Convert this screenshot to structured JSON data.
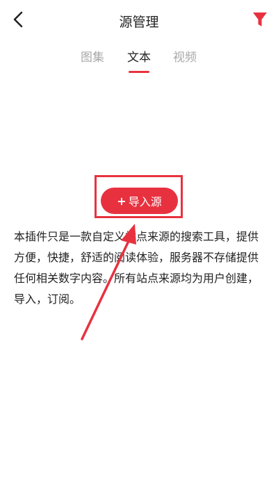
{
  "header": {
    "title": "源管理",
    "back_icon": "chevron-left-icon",
    "filter_icon": "filter-funnel-icon"
  },
  "tabs": [
    {
      "label": "图集",
      "active": false
    },
    {
      "label": "文本",
      "active": true
    },
    {
      "label": "视频",
      "active": false
    }
  ],
  "import_button": {
    "plus": "+",
    "label": "导入源"
  },
  "description": "本插件只是一款自定义站点来源的搜索工具，提供方便，快捷，舒适的阅读体验，服务器不存储提供任何相关数字内容。所有站点来源均为用户创建，导入，订阅。",
  "colors": {
    "accent": "#e8313f",
    "text": "#222222",
    "tab_inactive": "#a8a8a8",
    "background": "#ffffff"
  }
}
